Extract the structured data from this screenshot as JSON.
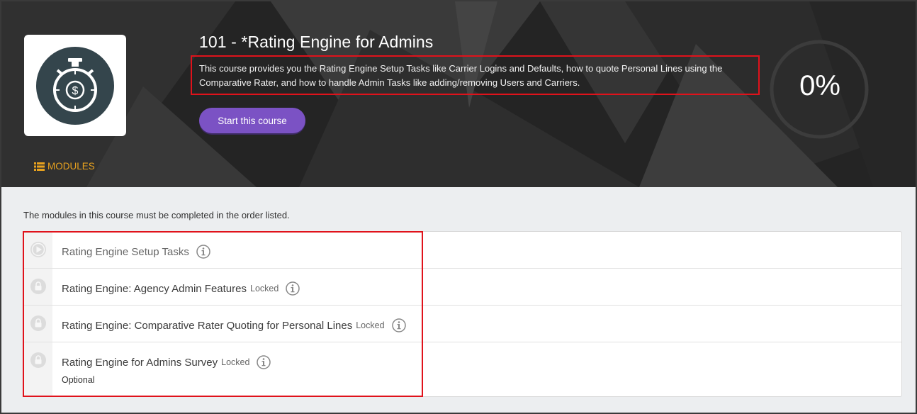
{
  "course": {
    "title": "101 - *Rating Engine for Admins",
    "description": "This course provides you the Rating Engine Setup Tasks like Carrier Logins and Defaults, how to quote Personal Lines using the Comparative Rater, and how to handle Admin Tasks like adding/removing Users and Carriers.",
    "start_label": "Start this course",
    "progress_text": "0%",
    "progress_value": 0,
    "logo_icon": "stopwatch-dollar-icon"
  },
  "tabs": {
    "modules_label": "MODULES",
    "modules_icon": "list-icon"
  },
  "content": {
    "order_note": "The modules in this course must be completed in the order listed.",
    "modules": [
      {
        "name": "Rating Engine Setup Tasks",
        "status_icon": "play-icon",
        "locked": "",
        "extra": ""
      },
      {
        "name": "Rating Engine: Agency Admin Features",
        "status_icon": "lock-icon",
        "locked": "Locked",
        "extra": ""
      },
      {
        "name": "Rating Engine: Comparative Rater Quoting for Personal Lines",
        "status_icon": "lock-icon",
        "locked": "Locked",
        "extra": ""
      },
      {
        "name": "Rating Engine for Admins Survey",
        "status_icon": "lock-icon",
        "locked": "Locked",
        "extra": "Optional"
      }
    ]
  },
  "colors": {
    "hero_bg": "#2a2a2a",
    "accent_purple": "#7b52c4",
    "modules_tab": "#e8a21f",
    "highlight_red": "#e0121b",
    "logo_circle": "#34454c"
  }
}
